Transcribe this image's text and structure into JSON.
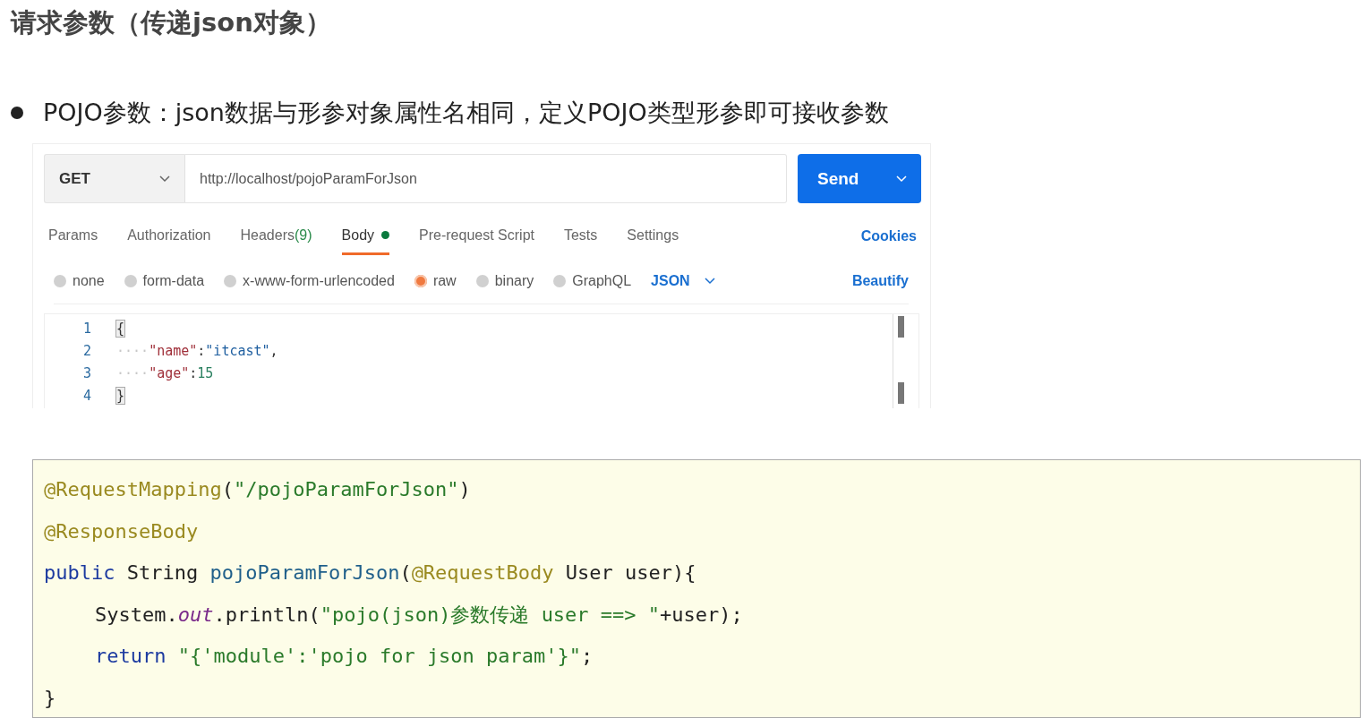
{
  "title": "请求参数（传递json对象）",
  "bullet": "POJO参数：json数据与形参对象属性名相同，定义POJO类型形参即可接收参数",
  "request": {
    "method": "GET",
    "url": "http://localhost/pojoParamForJson",
    "send": "Send"
  },
  "tabs": [
    {
      "label": "Params",
      "selected": false,
      "indicator": false
    },
    {
      "label": "Authorization",
      "selected": false,
      "indicator": false
    },
    {
      "label": "Headers",
      "count": "(9)",
      "selected": false,
      "indicator": false
    },
    {
      "label": "Body",
      "selected": true,
      "indicator": true
    },
    {
      "label": "Pre-request Script",
      "selected": false,
      "indicator": false
    },
    {
      "label": "Tests",
      "selected": false,
      "indicator": false
    },
    {
      "label": "Settings",
      "selected": false,
      "indicator": false
    }
  ],
  "cookies": "Cookies",
  "body_types": [
    {
      "label": "none",
      "selected": false
    },
    {
      "label": "form-data",
      "selected": false
    },
    {
      "label": "x-www-form-urlencoded",
      "selected": false
    },
    {
      "label": "raw",
      "selected": true
    },
    {
      "label": "binary",
      "selected": false
    },
    {
      "label": "GraphQL",
      "selected": false
    }
  ],
  "format": "JSON",
  "beautify": "Beautify",
  "editor_lines": [
    {
      "number": "1",
      "tokens": [
        {
          "kind": "bracket",
          "text": "{"
        }
      ]
    },
    {
      "number": "2",
      "tokens": [
        {
          "kind": "ws",
          "text": "····"
        },
        {
          "kind": "key",
          "text": "\"name\""
        },
        {
          "kind": "punct",
          "text": ":"
        },
        {
          "kind": "string",
          "text": "\"itcast\""
        },
        {
          "kind": "punct",
          "text": ","
        }
      ]
    },
    {
      "number": "3",
      "tokens": [
        {
          "kind": "ws",
          "text": "····"
        },
        {
          "kind": "key",
          "text": "\"age\""
        },
        {
          "kind": "punct",
          "text": ":"
        },
        {
          "kind": "number",
          "text": "15"
        }
      ]
    },
    {
      "number": "4",
      "tokens": [
        {
          "kind": "bracket",
          "text": "}"
        }
      ]
    }
  ],
  "code_lines": [
    {
      "indent": false,
      "tokens": [
        {
          "kind": "annotation",
          "text": "@RequestMapping"
        },
        {
          "kind": "plain",
          "text": "("
        },
        {
          "kind": "string",
          "text": "\"/pojoParamForJson\""
        },
        {
          "kind": "plain",
          "text": ")"
        }
      ]
    },
    {
      "indent": false,
      "tokens": [
        {
          "kind": "annotation",
          "text": "@ResponseBody"
        }
      ]
    },
    {
      "indent": false,
      "tokens": [
        {
          "kind": "keyword",
          "text": "public"
        },
        {
          "kind": "plain",
          "text": " String "
        },
        {
          "kind": "method",
          "text": "pojoParamForJson"
        },
        {
          "kind": "plain",
          "text": "("
        },
        {
          "kind": "annotation",
          "text": "@RequestBody"
        },
        {
          "kind": "plain",
          "text": " User user){"
        }
      ]
    },
    {
      "indent": true,
      "tokens": [
        {
          "kind": "plain",
          "text": "System."
        },
        {
          "kind": "field",
          "text": "out"
        },
        {
          "kind": "plain",
          "text": ".println("
        },
        {
          "kind": "string",
          "text": "\"pojo(json)参数传递 user ==> \""
        },
        {
          "kind": "plain",
          "text": "+user);"
        }
      ]
    },
    {
      "indent": true,
      "tokens": [
        {
          "kind": "keyword",
          "text": "return"
        },
        {
          "kind": "string",
          "text": " \"{'module':'pojo for json param'}\""
        },
        {
          "kind": "plain",
          "text": ";"
        }
      ]
    },
    {
      "indent": false,
      "tokens": [
        {
          "kind": "plain",
          "text": "}"
        }
      ]
    }
  ]
}
